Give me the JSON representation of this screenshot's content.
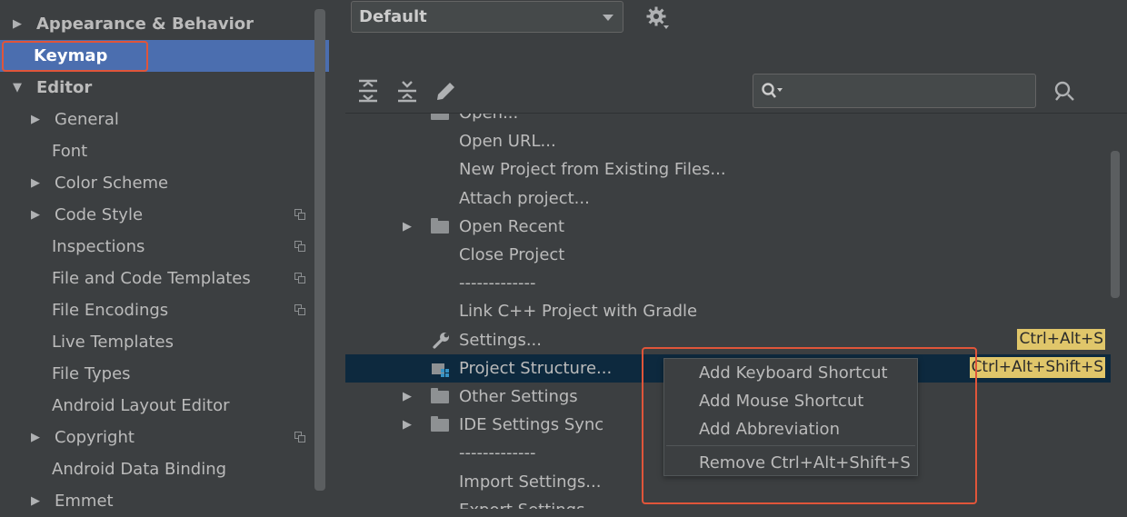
{
  "sidebar": {
    "items": [
      {
        "label": "Appearance & Behavior",
        "arrow": "▶",
        "bold": true
      },
      {
        "label": "Keymap",
        "bold": true,
        "selected": true
      },
      {
        "label": "Editor",
        "arrow": "▼",
        "bold": true
      },
      {
        "label": "General",
        "arrow": "▶"
      },
      {
        "label": "Font"
      },
      {
        "label": "Color Scheme",
        "arrow": "▶"
      },
      {
        "label": "Code Style",
        "arrow": "▶",
        "copy": true
      },
      {
        "label": "Inspections",
        "copy": true
      },
      {
        "label": "File and Code Templates",
        "copy": true
      },
      {
        "label": "File Encodings",
        "copy": true
      },
      {
        "label": "Live Templates"
      },
      {
        "label": "File Types"
      },
      {
        "label": "Android Layout Editor"
      },
      {
        "label": "Copyright",
        "arrow": "▶",
        "copy": true
      },
      {
        "label": "Android Data Binding"
      },
      {
        "label": "Emmet",
        "arrow": "▶"
      }
    ]
  },
  "keymap": {
    "scheme": "Default",
    "search": {
      "value": "",
      "placeholder": ""
    },
    "toolbar": [
      {
        "name": "expand-all-button",
        "icon": "expand-all-icon"
      },
      {
        "name": "collapse-all-button",
        "icon": "collapse-all-icon"
      },
      {
        "name": "edit-shortcut-button",
        "icon": "pencil-icon"
      }
    ],
    "actions": [
      {
        "label": "Open...",
        "icon": "folder"
      },
      {
        "label": "Open URL..."
      },
      {
        "label": "New Project from Existing Files..."
      },
      {
        "label": "Attach project..."
      },
      {
        "label": "Open Recent",
        "arrow": "▶",
        "icon": "folder"
      },
      {
        "label": "Close Project"
      },
      {
        "label": "-------------"
      },
      {
        "label": "Link C++ Project with Gradle"
      },
      {
        "label": "Settings...",
        "icon": "wrench",
        "shortcut": "Ctrl+Alt+S"
      },
      {
        "label": "Project Structure...",
        "icon": "project-structure",
        "shortcut": "Ctrl+Alt+Shift+S",
        "selected": true
      },
      {
        "label": "Other Settings",
        "arrow": "▶",
        "icon": "folder"
      },
      {
        "label": "IDE Settings Sync",
        "arrow": "▶",
        "icon": "folder"
      },
      {
        "label": "-------------"
      },
      {
        "label": "Import Settings..."
      },
      {
        "label": "Export Settings..."
      }
    ]
  },
  "context_menu": {
    "items": [
      "Add Keyboard Shortcut",
      "Add Mouse Shortcut",
      "Add Abbreviation",
      "Remove Ctrl+Alt+Shift+S"
    ]
  },
  "colors": {
    "background": "#3c3f41",
    "selection": "#4b6eaf",
    "row_selection": "#0d293e",
    "shortcut_badge": "#e0c66a",
    "annotation": "#e0553a"
  }
}
